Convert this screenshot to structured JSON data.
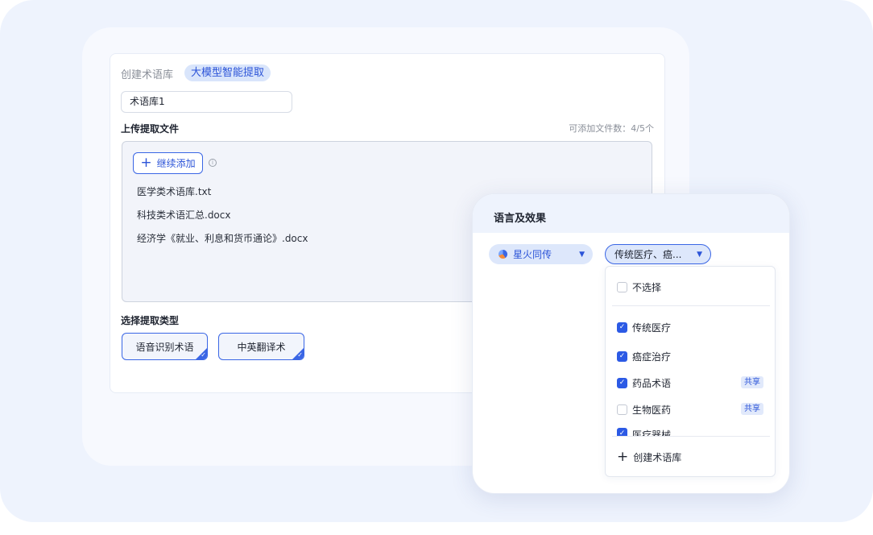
{
  "header": {
    "crumb": "创建术语库",
    "ai_tag": "大模型智能提取"
  },
  "name_input": {
    "value": "术语库1"
  },
  "upload": {
    "label": "上传提取文件",
    "count_note": "可添加文件数：4/5个",
    "add_label": "继续添加",
    "files": [
      "医学类术语库.txt",
      "科技类术语汇总.docx",
      "经济学《就业、利息和货币通论》.docx"
    ]
  },
  "extract_type": {
    "label": "选择提取类型",
    "options": [
      "语音识别术语",
      "中英翻译术"
    ]
  },
  "popup": {
    "title": "语言及效果",
    "engine": "星火同传",
    "domain_select": "传统医疗、癌...",
    "options": [
      {
        "label": "不选择",
        "checked": false
      },
      {
        "label": "传统医疗",
        "checked": true
      },
      {
        "label": "癌症治疗",
        "checked": true
      },
      {
        "label": "药品术语",
        "checked": true,
        "badge": "共享"
      },
      {
        "label": "生物医药",
        "checked": false,
        "badge": "共享"
      },
      {
        "label": "医疗器械",
        "checked": true
      }
    ],
    "create_label": "创建术语库"
  },
  "colors": {
    "accent": "#2c5ae5",
    "tag_bg": "#dde7fb",
    "frame_bg": "#eef3fd"
  }
}
